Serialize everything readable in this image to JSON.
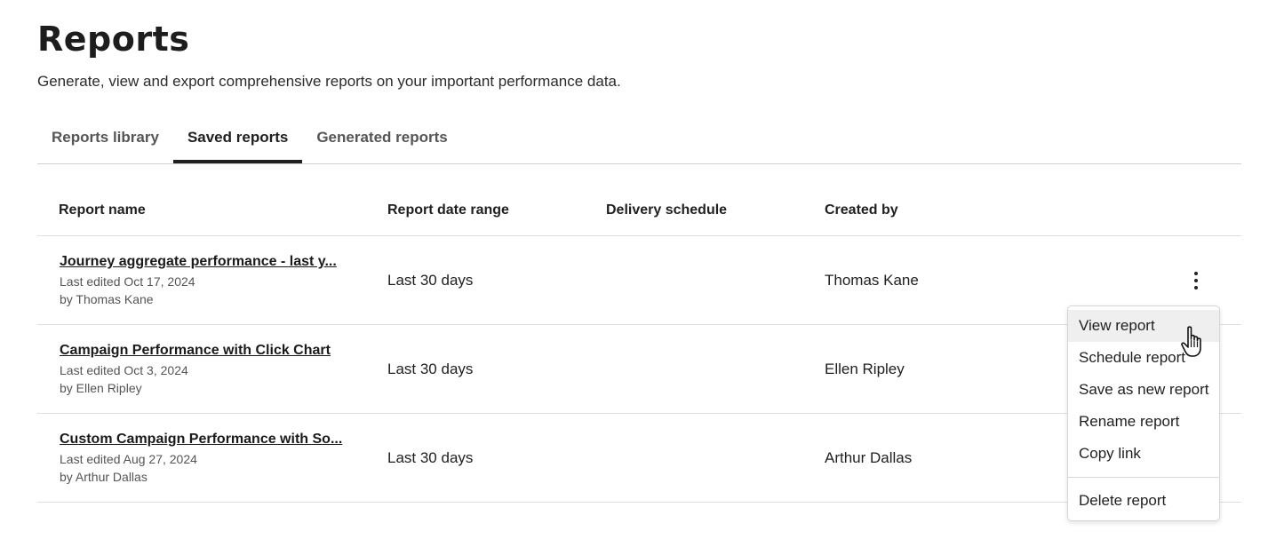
{
  "page": {
    "title": "Reports",
    "subtitle": "Generate, view and export comprehensive reports on your important performance data."
  },
  "tabs": [
    {
      "label": "Reports library",
      "active": false
    },
    {
      "label": "Saved reports",
      "active": true
    },
    {
      "label": "Generated reports",
      "active": false
    }
  ],
  "table": {
    "columns": [
      "Report name",
      "Report date range",
      "Delivery schedule",
      "Created by"
    ],
    "rows": [
      {
        "name": "Journey aggregate performance - last y...",
        "edited": "Last edited Oct 17, 2024",
        "by": "by Thomas Kane",
        "date_range": "Last 30 days",
        "delivery_schedule": "",
        "created_by": "Thomas Kane"
      },
      {
        "name": "Campaign Performance with Click Chart",
        "edited": "Last edited Oct 3, 2024",
        "by": "by Ellen Ripley",
        "date_range": "Last 30 days",
        "delivery_schedule": "",
        "created_by": "Ellen Ripley"
      },
      {
        "name": "Custom Campaign Performance with So...",
        "edited": "Last edited Aug 27, 2024",
        "by": "by Arthur Dallas",
        "date_range": "Last 30 days",
        "delivery_schedule": "",
        "created_by": "Arthur Dallas"
      }
    ]
  },
  "row_menu": {
    "open_for_row": 0,
    "hovered_item": "View report",
    "items": [
      "View report",
      "Schedule report",
      "Save as new report",
      "Rename report",
      "Copy link"
    ],
    "danger_item": "Delete report"
  },
  "icons": {
    "row_actions": "more-vertical-icon",
    "cursor": "hand-pointer-cursor-icon"
  },
  "colors": {
    "text": "#1f1f1f",
    "muted": "#555555",
    "divider": "#dedede",
    "menu_hover": "#efefef"
  }
}
